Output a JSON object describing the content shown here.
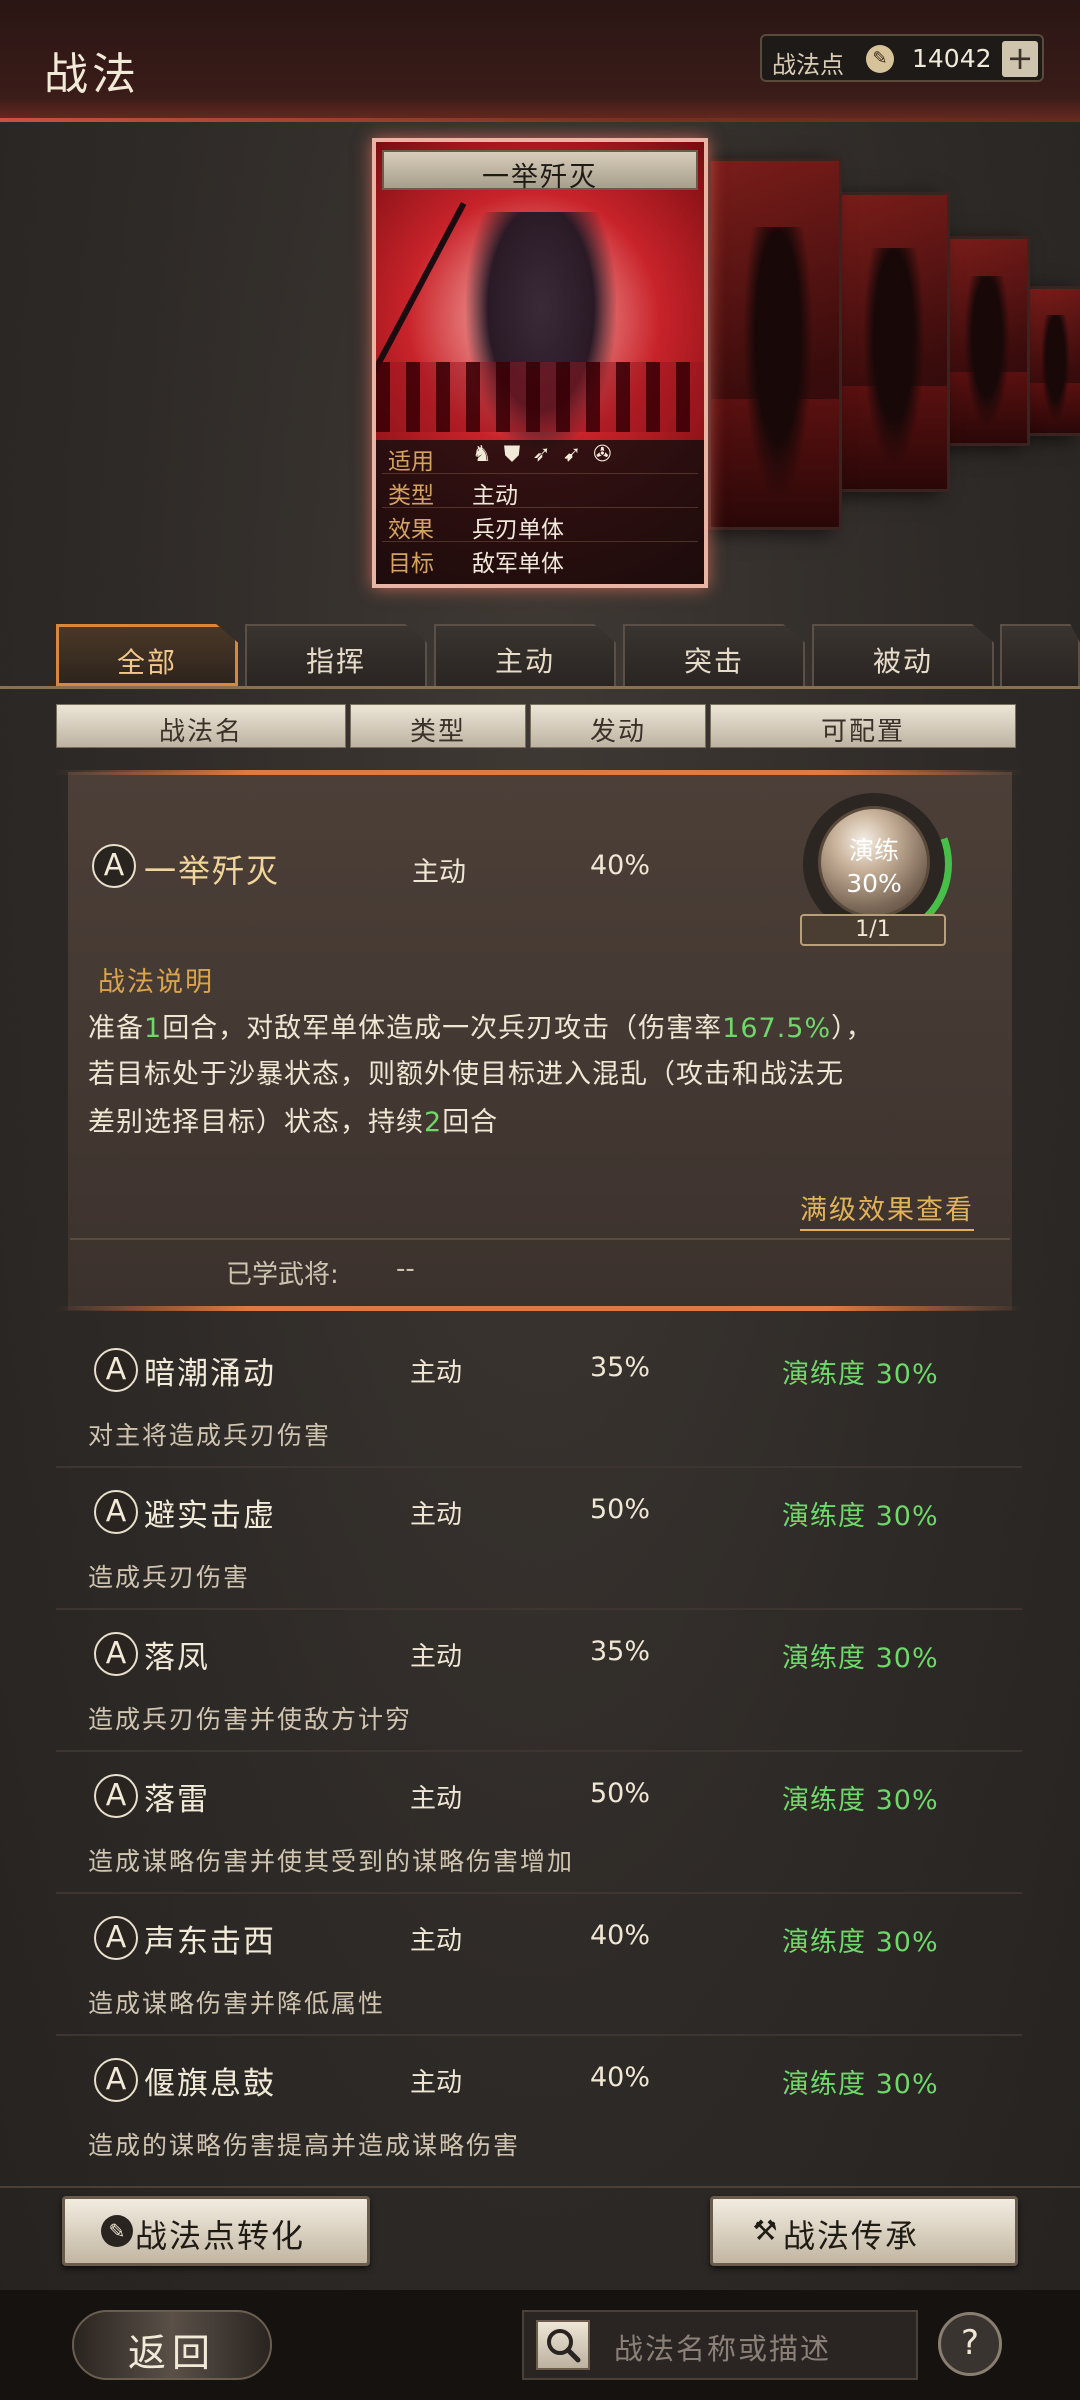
{
  "header": {
    "title": "战法",
    "points_label": "战法点",
    "points_value": "14042",
    "add_label": "+"
  },
  "featured_card": {
    "title": "一举歼灭",
    "info": [
      {
        "key": "适用",
        "value": ""
      },
      {
        "key": "类型",
        "value": "主动"
      },
      {
        "key": "效果",
        "value": "兵刃单体"
      },
      {
        "key": "目标",
        "value": "敌军单体"
      }
    ],
    "unit_icons": [
      "cavalry-icon",
      "shield-icon",
      "archer-icon",
      "spear-icon",
      "chariot-icon"
    ]
  },
  "tabs": [
    {
      "label": "全部",
      "active": true
    },
    {
      "label": "指挥"
    },
    {
      "label": "主动"
    },
    {
      "label": "突击"
    },
    {
      "label": "被动"
    }
  ],
  "columns": [
    "战法名",
    "类型",
    "发动",
    "可配置"
  ],
  "expanded": {
    "grade": "A",
    "name": "一举歼灭",
    "type": "主动",
    "rate": "40%",
    "orb_label": "演练",
    "orb_value": "30%",
    "orb_progress": 0.3,
    "count": "1/1",
    "desc_title": "战法说明",
    "desc_line1_pre": "准备",
    "desc_line1_n": "1",
    "desc_line1_mid": "回合，对敌军单体造成一次兵刃攻击（伤害率",
    "desc_line1_pct": "167.5%",
    "desc_line1_post": "），",
    "desc_line2": "若目标处于沙暴状态，则额外使目标进入混乱（攻击和战法无",
    "desc_line3_pre": "差别选择目标）状态，持续",
    "desc_line3_n": "2",
    "desc_line3_post": "回合",
    "max_link": "满级效果查看",
    "learned_label": "已学武将:",
    "learned_value": "--"
  },
  "list": [
    {
      "grade": "A",
      "name": "暗潮涌动",
      "type": "主动",
      "rate": "35%",
      "progress": "演练度 30%",
      "desc": "对主将造成兵刃伤害"
    },
    {
      "grade": "A",
      "name": "避实击虚",
      "type": "主动",
      "rate": "50%",
      "progress": "演练度 30%",
      "desc": "造成兵刃伤害"
    },
    {
      "grade": "A",
      "name": "落凤",
      "type": "主动",
      "rate": "35%",
      "progress": "演练度 30%",
      "desc": "造成兵刃伤害并使敌方计穷"
    },
    {
      "grade": "A",
      "name": "落雷",
      "type": "主动",
      "rate": "50%",
      "progress": "演练度 30%",
      "desc": "造成谋略伤害并使其受到的谋略伤害增加"
    },
    {
      "grade": "A",
      "name": "声东击西",
      "type": "主动",
      "rate": "40%",
      "progress": "演练度 30%",
      "desc": "造成谋略伤害并降低属性"
    },
    {
      "grade": "A",
      "name": "偃旗息鼓",
      "type": "主动",
      "rate": "40%",
      "progress": "演练度 30%",
      "desc": "造成的谋略伤害提高并造成谋略伤害"
    }
  ],
  "bottom": {
    "convert_label": "战法点转化",
    "inherit_label": "战法传承"
  },
  "footer": {
    "back_label": "返回",
    "search_placeholder": "战法名称或描述",
    "help_label": "?"
  }
}
